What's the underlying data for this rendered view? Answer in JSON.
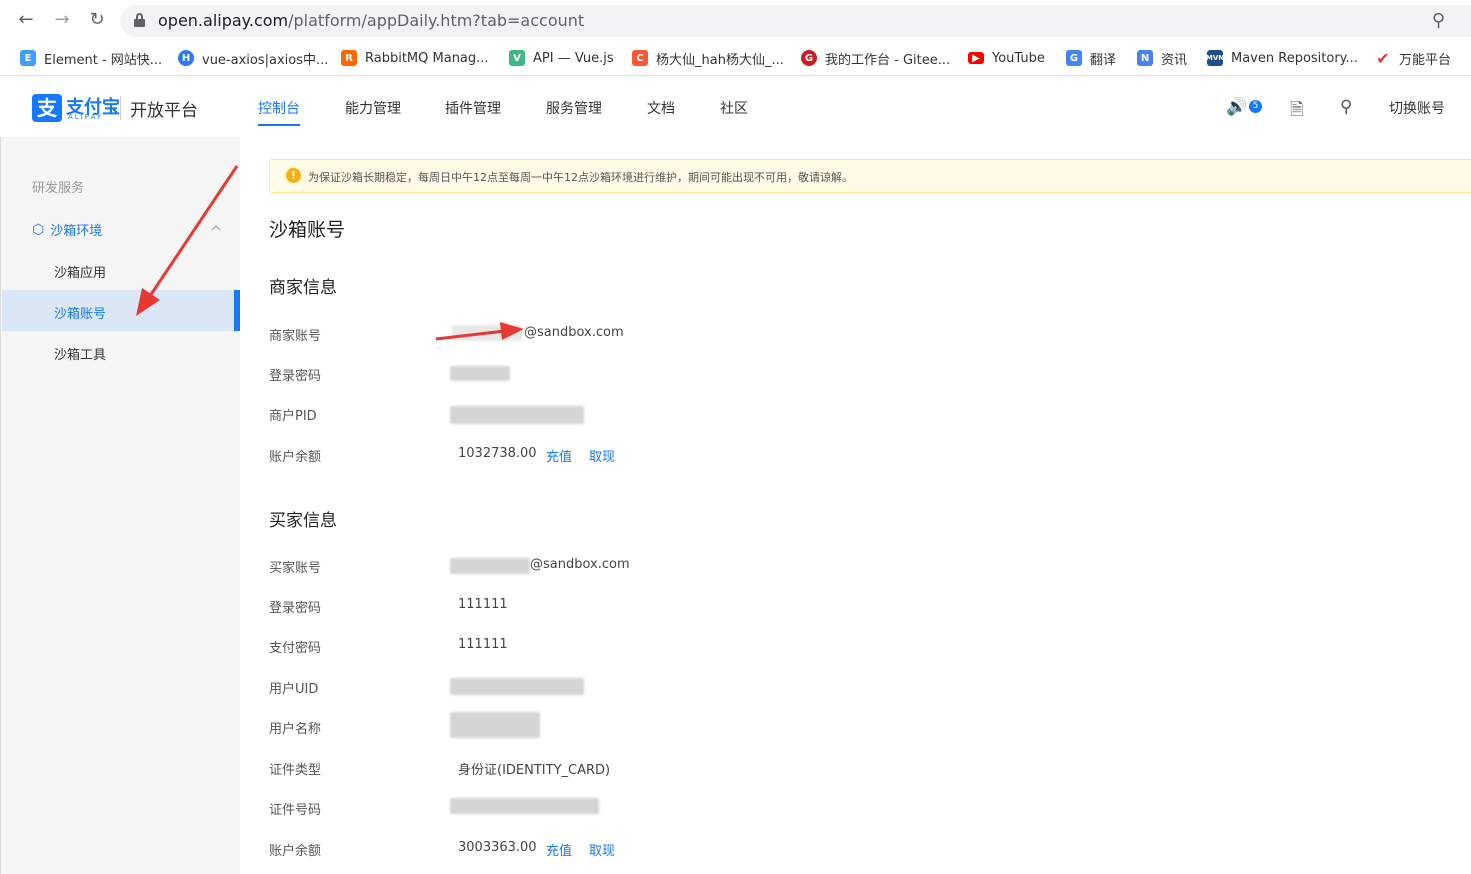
{
  "browser": {
    "url_host": "open.alipay.com",
    "url_path": "/platform/appDaily.htm?tab=account",
    "bookmarks": [
      {
        "label": "Element - 网站快...",
        "icon": "element-icon",
        "color": "#409eff"
      },
      {
        "label": "vue-axios|axios中...",
        "icon": "h-icon",
        "color": "#2979ff"
      },
      {
        "label": "RabbitMQ Manag...",
        "icon": "rabbitmq-icon",
        "color": "#ff6600"
      },
      {
        "label": "API — Vue.js",
        "icon": "vue-icon",
        "color": "#41b883"
      },
      {
        "label": "杨大仙_hah杨大仙_...",
        "icon": "csdn-icon",
        "color": "#fc5531"
      },
      {
        "label": "我的工作台 - Gitee...",
        "icon": "gitee-icon",
        "color": "#c71d23"
      },
      {
        "label": "YouTube",
        "icon": "youtube-icon",
        "color": "#ff0000"
      },
      {
        "label": "翻译",
        "icon": "translate-icon",
        "color": "#4285f4"
      },
      {
        "label": "资讯",
        "icon": "news-icon",
        "color": "#4285f4"
      },
      {
        "label": "Maven Repository...",
        "icon": "maven-icon",
        "color": "#1f4e8c"
      },
      {
        "label": "万能平台",
        "icon": "check-icon",
        "color": "#e53935"
      }
    ]
  },
  "header": {
    "logo_text": "支付宝",
    "logo_sub": "ALIPAY",
    "platform": "开放平台",
    "nav": [
      "控制台",
      "能力管理",
      "插件管理",
      "服务管理",
      "文档",
      "社区"
    ],
    "active_nav": "控制台",
    "badge": "5",
    "switch_account": "切换账号"
  },
  "sidebar": {
    "group": "研发服务",
    "section": "沙箱环境",
    "items": [
      "沙箱应用",
      "沙箱账号",
      "沙箱工具"
    ],
    "active": "沙箱账号"
  },
  "notice": "为保证沙箱长期稳定，每周日中午12点至每周一中午12点沙箱环境进行维护，期间可能出现不可用，敬请谅解。",
  "page_title": "沙箱账号",
  "merchant": {
    "title": "商家信息",
    "rows": [
      {
        "label": "商家账号",
        "value": "@sandbox.com"
      },
      {
        "label": "登录密码",
        "value": ""
      },
      {
        "label": "商户PID",
        "value": ""
      },
      {
        "label": "账户余额",
        "value": "1032738.00"
      }
    ],
    "recharge": "充值",
    "withdraw": "取现"
  },
  "buyer": {
    "title": "买家信息",
    "rows": [
      {
        "label": "买家账号",
        "value": "@sandbox.com"
      },
      {
        "label": "登录密码",
        "value": "111111"
      },
      {
        "label": "支付密码",
        "value": "111111"
      },
      {
        "label": "用户UID",
        "value": ""
      },
      {
        "label": "用户名称",
        "value": ""
      },
      {
        "label": "证件类型",
        "value": "身份证(IDENTITY_CARD)"
      },
      {
        "label": "证件号码",
        "value": ""
      },
      {
        "label": "账户余额",
        "value": "3003363.00"
      }
    ],
    "recharge": "充值",
    "withdraw": "取现"
  }
}
